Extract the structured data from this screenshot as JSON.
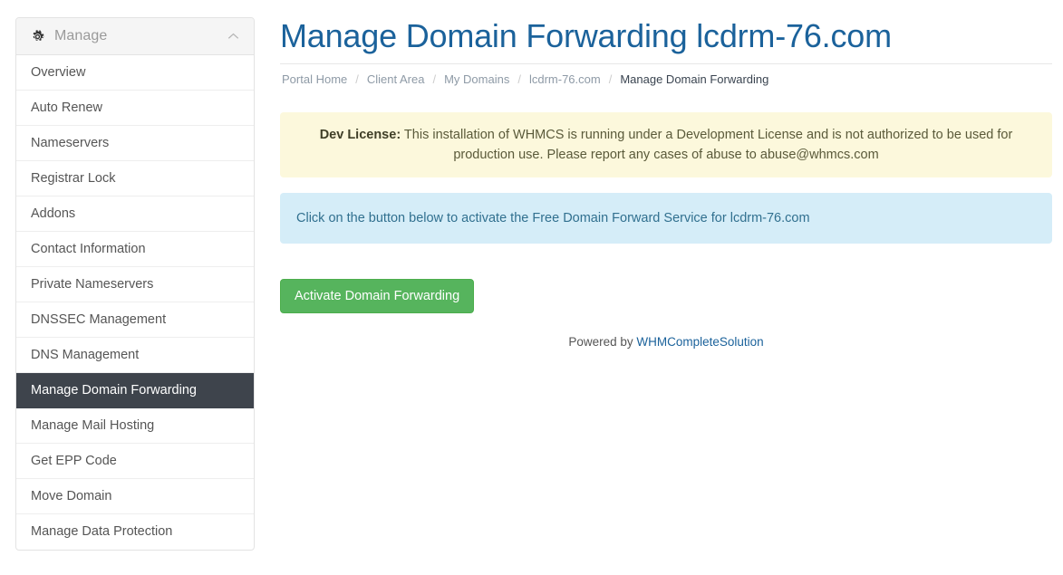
{
  "sidebar": {
    "header": {
      "title": "Manage",
      "gear_icon": "gear-icon",
      "collapse_icon": "chevron-up-icon"
    },
    "items": [
      {
        "label": "Overview",
        "active": false
      },
      {
        "label": "Auto Renew",
        "active": false
      },
      {
        "label": "Nameservers",
        "active": false
      },
      {
        "label": "Registrar Lock",
        "active": false
      },
      {
        "label": "Addons",
        "active": false
      },
      {
        "label": "Contact Information",
        "active": false
      },
      {
        "label": "Private Nameservers",
        "active": false
      },
      {
        "label": "DNSSEC Management",
        "active": false
      },
      {
        "label": "DNS Management",
        "active": false
      },
      {
        "label": "Manage Domain Forwarding",
        "active": true
      },
      {
        "label": "Manage Mail Hosting",
        "active": false
      },
      {
        "label": "Get EPP Code",
        "active": false
      },
      {
        "label": "Move Domain",
        "active": false
      },
      {
        "label": "Manage Data Protection",
        "active": false
      }
    ]
  },
  "main": {
    "page_title": "Manage Domain Forwarding lcdrm-76.com",
    "breadcrumb": [
      {
        "label": "Portal Home",
        "active": false
      },
      {
        "label": "Client Area",
        "active": false
      },
      {
        "label": "My Domains",
        "active": false
      },
      {
        "label": "lcdrm-76.com",
        "active": false
      },
      {
        "label": "Manage Domain Forwarding",
        "active": true
      }
    ],
    "breadcrumb_separator": "/",
    "dev_license_alert": {
      "label": "Dev License:",
      "text": " This installation of WHMCS is running under a Development License and is not authorized to be used for production use. Please report any cases of abuse to abuse@whmcs.com"
    },
    "info_alert": {
      "text": "Click on the button below to activate the Free Domain Forward Service for lcdrm-76.com"
    },
    "activate_button": "Activate Domain Forwarding",
    "footer": {
      "prefix": "Powered by ",
      "link": "WHMCompleteSolution"
    }
  },
  "colors": {
    "title_blue": "#1b629b",
    "active_sidebar_bg": "#3e444c",
    "button_green": "#56b45d",
    "alert_warning_bg": "#fcf8dc",
    "alert_info_bg": "#d5edf8"
  }
}
